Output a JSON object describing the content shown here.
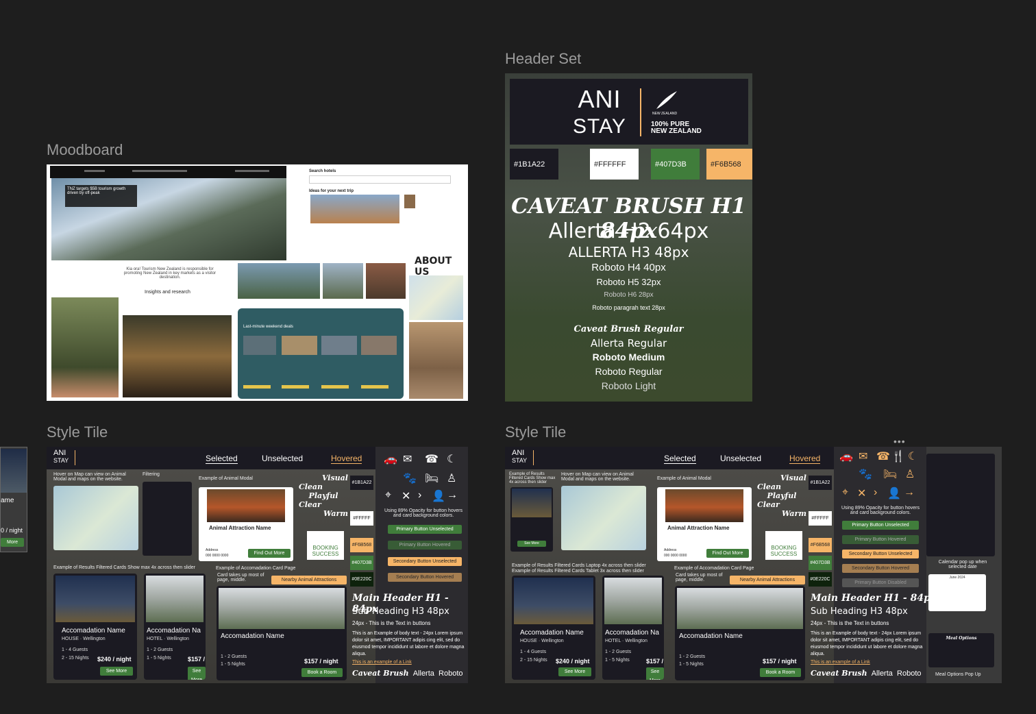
{
  "frames": {
    "moodboard": "Moodboard",
    "header_set": "Header Set",
    "style_tile_1": "Style Tile",
    "style_tile_2": "Style Tile"
  },
  "moodboard": {
    "hero_text": "TNZ targets $5B tourism growth driven by off-peak",
    "intro": "Kia ora! Tourism New Zealand is responsible for promoting New Zealand in key markets as a visitor destination.",
    "insights": "Insights and research",
    "search_hotels": "Search hotels",
    "ideas": "Ideas for your next trip",
    "about_us": "ABOUT US",
    "deals_title": "Last-minute weekend deals"
  },
  "header_set": {
    "logo_line1": "ANI",
    "logo_line2": "STAY",
    "nz_line1": "NEW ZEALAND",
    "nz_line2": "100% PURE",
    "nz_line3": "NEW ZEALAND",
    "swatches": [
      {
        "label": "#1B1A22",
        "color": "#1B1A22"
      },
      {
        "label": "#FFFFFF",
        "color": "#FFFFFF"
      },
      {
        "label": "#407D3B",
        "color": "#407D3B"
      },
      {
        "label": "#F6B568",
        "color": "#F6B568"
      }
    ],
    "type_scale": [
      "CAVEAT BRUSH H1 84px",
      "Allerta H2 64px",
      "ALLERTA H3 48px",
      "Roboto H4 40px",
      "Roboto H5 32px",
      "Roboto H6 28px",
      "Roboto paragrah text 28px"
    ],
    "font_list": [
      "Caveat Brush Regular",
      "Allerta Regular",
      "Roboto Medium",
      "Roboto Regular",
      "Roboto Light"
    ]
  },
  "tile": {
    "logo1": "ANI",
    "logo2": "STAY",
    "tab_selected": "Selected",
    "tab_unselected": "Unselected",
    "tab_hovered": "Hovered",
    "hover_note": "Hover on Map can view on Animal Modal and maps on the website.",
    "filtering": "Filtering",
    "animal_modal_caption": "Example of Animal Modal",
    "animal_name": "Animal Attraction Name",
    "address": "Address",
    "phone": "000 0000 0000",
    "find_out_more": "Find Out More",
    "visual_words": [
      "Visual",
      "Clean",
      "Playful",
      "Clear",
      "Warm"
    ],
    "booking_success": "BOOKING SUCCESS",
    "swatches": [
      "#1B1A22",
      "#FFFFF",
      "#F6B568",
      "#407D3B",
      "#0E220C"
    ],
    "opacity_note": "Using 89% Opacity for button hovers and card background colors.",
    "btn_primary_unsel": "Primary Button Unselected",
    "btn_primary_hov": "Primary Button Hovered",
    "btn_secondary_unsel": "Secondary Button Unselected",
    "btn_secondary_hov": "Secondary Button Hovered",
    "btn_primary_dis": "Primary Button Disabled",
    "results_caption": "Example of Results Filtered Cards Show max 4x across then slider",
    "accom_caption": "Example of Accomadation Card Page",
    "accom_note": "Card takes up most of page, middle.",
    "nearby": "Nearby Animal Attractions",
    "card1_name": "Accomadation Name",
    "card1_type": "HOUSE",
    "card1_loc": "Wellington",
    "card1_guests": "1 - 4 Guests",
    "card1_nights": "2 - 15 Nights",
    "card1_price": "$240 / night",
    "card2_name": "Accomadation Na",
    "card2_type": "HOTEL",
    "card2_guests": "1 - 2 Guests",
    "card2_nights": "1 - 5 Nights",
    "card2_price": "$157 /",
    "card3_price": "$157 / night",
    "card3_guests": "1 - 2 Guests",
    "card3_nights": "1 - 5 Nights",
    "see_more": "See More",
    "book_room": "Book a Room",
    "main_header": "Main Header H1 - 84px",
    "sub_heading": "Sub Heading H3 48px",
    "button_text": "24px - This is the Text in buttons",
    "body_text": "This is an Example of body text - 24px Lorem ipsum dolor sit amet, IMPORTANT adipis cing elit, sed do eiusmod tempor incididunt ut labore et dolore magna aliqua.",
    "link_text": "This is an example of a Link",
    "fonts_row": [
      "Caveat Brush",
      "Allerta",
      "Roboto"
    ],
    "calendar_note": "Calendar pop up when selected date",
    "calendar_month": "June 2024",
    "meal_options": "Meal Options",
    "meal_popup": "Meal Options Pop Up",
    "results_caption_2": "Example of Results Filtered Cards Laptop 4x across then slider",
    "results_caption_3": "Example of Results Filtered Cards Tablet 3x across then slider"
  },
  "side_clip": {
    "name": "ame",
    "price": "0 / night",
    "more": "More"
  }
}
